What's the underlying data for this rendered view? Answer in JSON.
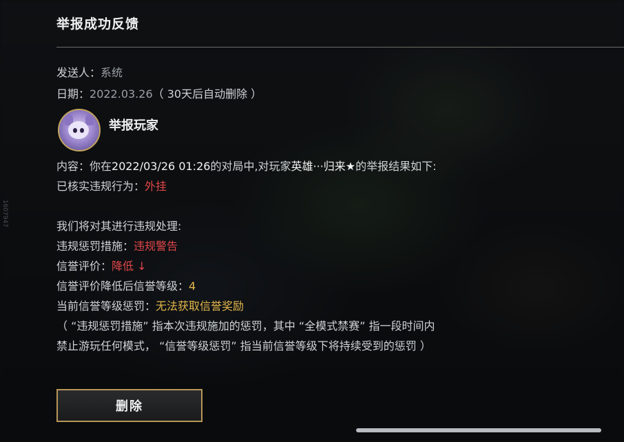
{
  "dialog": {
    "title": "举报成功反馈",
    "side_code": "1607947"
  },
  "meta": {
    "sender_label": "发送人：",
    "sender_value": "系统",
    "date_label": "日期：",
    "date_value": "2022.03.26",
    "date_note": "（ 30天后自动删除 ）"
  },
  "reporter": {
    "avatar_icon": "bear-champion-avatar-icon",
    "title": "举报玩家"
  },
  "content": {
    "prefix": "内容：你在",
    "datetime": "2022/03/26 01:26",
    "mid": "的对局中,对玩家",
    "player": "英雄···归来★",
    "suffix": "的举报结果如下:",
    "verified_label": "已核实违规行为：",
    "verified_value": "外挂",
    "process_line": "我们将对其进行违规处理:",
    "penalty_label": "违规惩罚措施：",
    "penalty_value": "违规警告",
    "credit_label": "信誉评价：",
    "credit_value": "降低 ↓",
    "credit_level_label": "信誉评价降低后信誉等级：",
    "credit_level_value": "4",
    "current_penalty_label": "当前信誉等级惩罚：",
    "current_penalty_value": "无法获取信誉奖励",
    "note_line1": "（ “违规惩罚措施” 指本次违规施加的惩罚，其中 “全模式禁赛” 指一段时间内",
    "note_line2": "禁止游玩任何模式， “信誉等级惩罚” 指当前信誉等级下将持续受到的惩罚 ）"
  },
  "actions": {
    "delete_label": "删除"
  },
  "colors": {
    "accent_red": "#e0474a",
    "accent_yellow": "#e3b64b",
    "button_border": "#b8975a"
  }
}
